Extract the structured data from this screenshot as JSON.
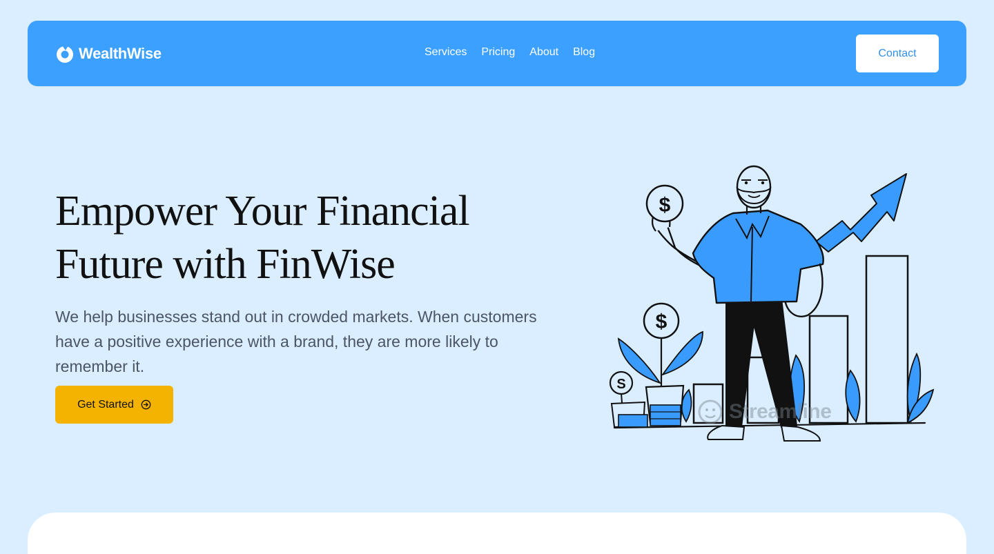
{
  "brand": {
    "name": "WealthWise",
    "logo_icon": "drop-logo-icon"
  },
  "nav": {
    "links": [
      "Services",
      "Pricing",
      "About",
      "Blog"
    ],
    "contact_label": "Contact"
  },
  "hero": {
    "title_line1": "Empower Your Financial",
    "title_line2": "Future with FinWise",
    "subtitle": "We help businesses stand out in crowded markets. When customers have a positive experience with a brand, they are more likely to remember it.",
    "cta_label": "Get Started",
    "cta_icon": "arrow-right-circle-icon"
  },
  "illustration": {
    "subject": "man-with-coins-and-growth-chart",
    "coin_symbol": "$",
    "small_coin_symbol": "S",
    "watermark": "Streamline"
  },
  "colors": {
    "background": "#dbeeff",
    "navbar": "#3ba0ff",
    "accent_blue": "#3a9bff",
    "cta": "#f5b301",
    "title_text": "#111111",
    "body_text": "#4b5563"
  }
}
